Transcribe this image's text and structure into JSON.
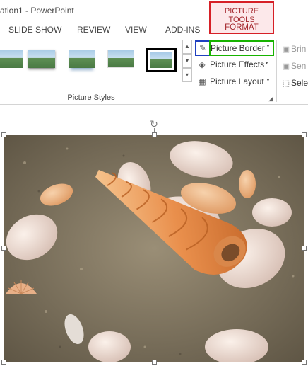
{
  "window": {
    "title": "ation1 - PowerPoint"
  },
  "context_tabs": {
    "group_label": "PICTURE TOOLS",
    "tab_label": "FORMAT"
  },
  "tabs": [
    {
      "label": "SLIDE SHOW"
    },
    {
      "label": "REVIEW"
    },
    {
      "label": "VIEW"
    },
    {
      "label": "ADD-INS"
    }
  ],
  "picture_styles": {
    "group_label": "Picture Styles",
    "styles": [
      {
        "name": "simple-frame"
      },
      {
        "name": "drop-shadow"
      },
      {
        "name": "reflected"
      },
      {
        "name": "soft-edge"
      },
      {
        "name": "thick-black-border",
        "selected": true
      }
    ]
  },
  "commands": {
    "border": {
      "label": "Picture Border",
      "icon": "pencil-border-icon"
    },
    "effects": {
      "label": "Picture Effects",
      "icon": "effects-icon"
    },
    "layout": {
      "label": "Picture Layout",
      "icon": "layout-icon"
    }
  },
  "arrange": {
    "items": [
      {
        "label": "Brin",
        "icon": "bring-forward-icon"
      },
      {
        "label": "Sen",
        "icon": "send-backward-icon"
      },
      {
        "label": "Sele",
        "icon": "selection-pane-icon"
      }
    ]
  },
  "colors": {
    "context_red": "#d62027",
    "border_highlight_blue": "#1f3fbf",
    "label_highlight_green": "#18b300"
  }
}
